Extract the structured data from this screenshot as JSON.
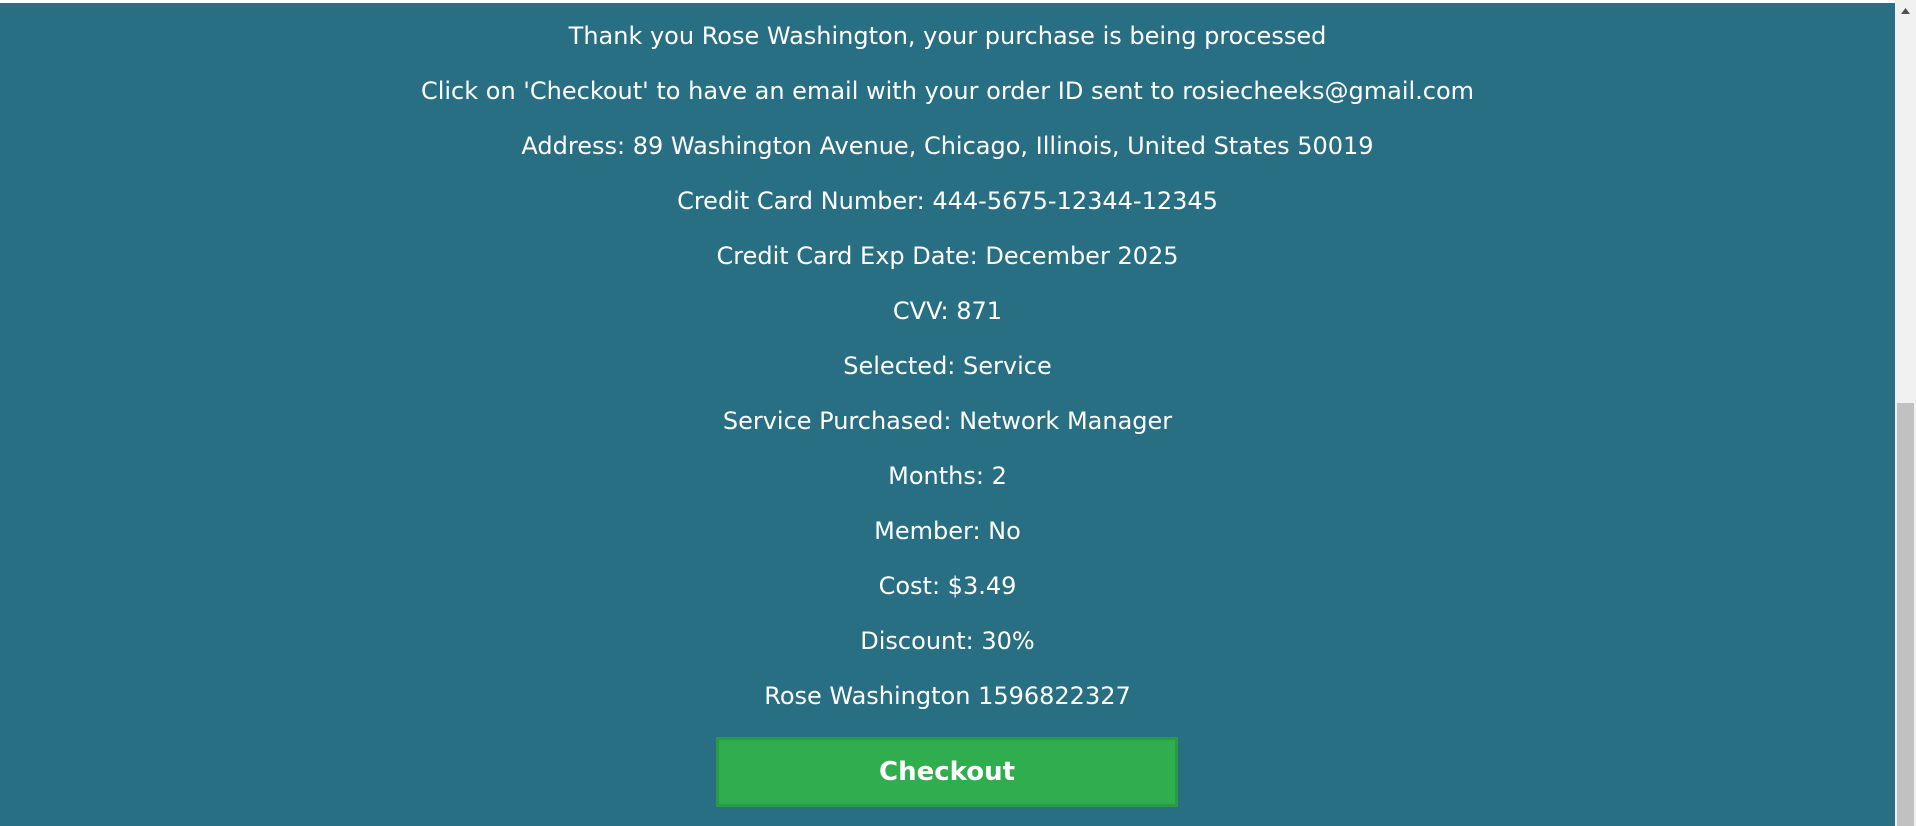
{
  "confirmation": {
    "thank_you": "Thank you Rose Washington, your purchase is being processed",
    "email_notice": "Click on 'Checkout' to have an email with your order ID sent to rosiecheeks@gmail.com",
    "address": "Address: 89 Washington Avenue, Chicago, Illinois, United States 50019",
    "card_number": "Credit Card Number: 444-5675-12344-12345",
    "card_exp": "Credit Card Exp Date: December 2025",
    "cvv": "CVV: 871",
    "selected": "Selected: Service",
    "service": "Service Purchased: Network Manager",
    "months": "Months: 2",
    "member": "Member: No",
    "cost": "Cost: $3.49",
    "discount": "Discount: 30%",
    "customer": "Rose Washington 1596822327"
  },
  "checkout_button": {
    "label": "Checkout"
  },
  "colors": {
    "background": "#286f84",
    "button": "#30ad4e",
    "text": "#ffffff"
  },
  "icons": {
    "scroll_up": "scroll-up-arrow-icon"
  }
}
